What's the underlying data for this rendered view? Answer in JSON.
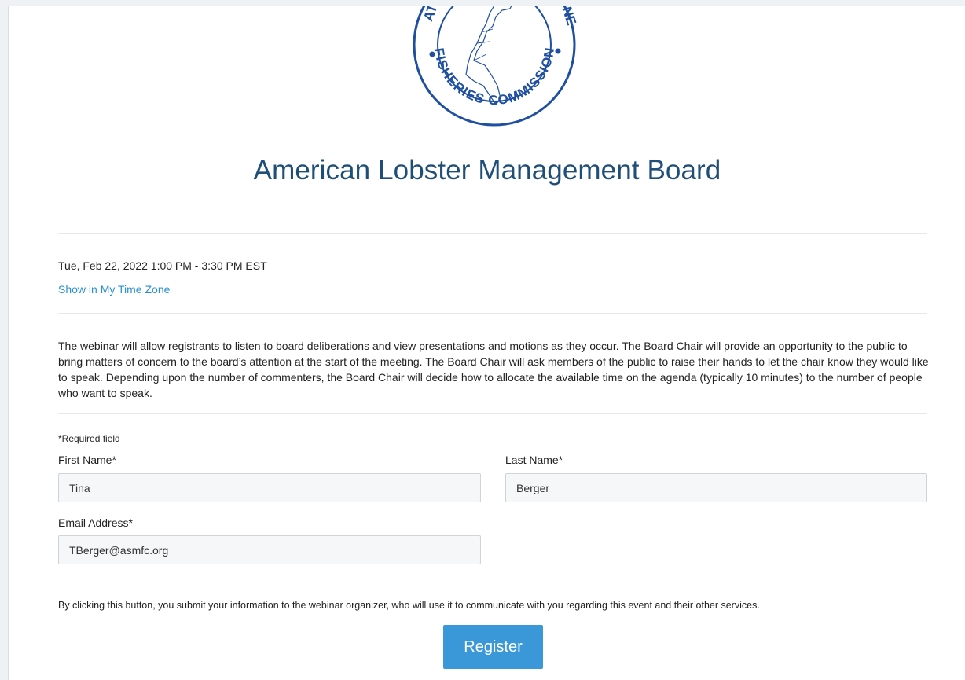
{
  "logo": {
    "text_top_left": "ATL",
    "text_top_right": "NE",
    "text_bottom": "FISHERIES COMMISSION",
    "ring_color": "#1f4fa0"
  },
  "event": {
    "title": "American Lobster Management Board",
    "datetime": "Tue, Feb 22, 2022 1:00 PM - 3:30 PM EST",
    "timezone_link": "Show in My Time Zone",
    "description": "The webinar will allow registrants to listen to board deliberations and view presentations and motions as they occur.  The Board Chair will provide an opportunity to the public to bring matters of concern to the board’s attention at the start of the meeting. The Board Chair will ask members of the public to raise their hands to let the chair know they would like to speak. Depending upon the number of commenters, the Board Chair will decide how to allocate the available time on the agenda (typically 10 minutes) to the number of people who want to speak."
  },
  "form": {
    "required_note": "*Required field",
    "first_name": {
      "label": "First Name*",
      "value": "Tina"
    },
    "last_name": {
      "label": "Last Name*",
      "value": "Berger"
    },
    "email": {
      "label": "Email Address*",
      "value": "TBerger@asmfc.org"
    },
    "consent_text": "By clicking this button, you submit your information to the webinar organizer, who will use it to communicate with you regarding this event and their other services.",
    "register_label": "Register"
  },
  "colors": {
    "title": "#1f4e79",
    "link": "#2a90d3",
    "button": "#3a98d8"
  }
}
